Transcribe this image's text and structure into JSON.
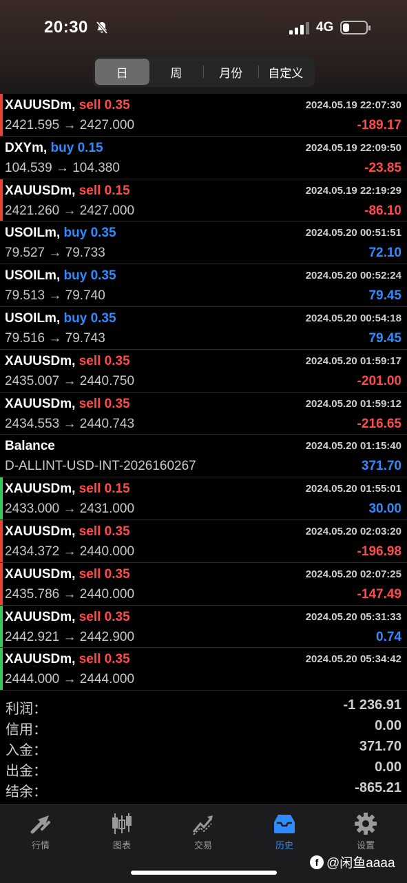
{
  "status": {
    "time": "20:30",
    "network": "4G"
  },
  "segments": [
    {
      "label": "日",
      "active": true
    },
    {
      "label": "周",
      "active": false
    },
    {
      "label": "月份",
      "active": false
    },
    {
      "label": "自定义",
      "active": false
    }
  ],
  "trades": [
    {
      "symbol": "XAUUSDm,",
      "side": "sell",
      "volume": "0.35",
      "date": "2024.05.19 22:07:30",
      "prices": "2421.595 → 2427.000",
      "profit": "-189.17",
      "bar": "#e8413a"
    },
    {
      "symbol": "DXYm,",
      "side": "buy",
      "volume": "0.15",
      "date": "2024.05.19 22:09:50",
      "prices": "104.539 → 104.380",
      "profit": "-23.85",
      "bar": ""
    },
    {
      "symbol": "XAUUSDm,",
      "side": "sell",
      "volume": "0.15",
      "date": "2024.05.19 22:19:29",
      "prices": "2421.260 → 2427.000",
      "profit": "-86.10",
      "bar": "#e8413a"
    },
    {
      "symbol": "USOILm,",
      "side": "buy",
      "volume": "0.35",
      "date": "2024.05.20 00:51:51",
      "prices": "79.527 → 79.733",
      "profit": "72.10",
      "bar": ""
    },
    {
      "symbol": "USOILm,",
      "side": "buy",
      "volume": "0.35",
      "date": "2024.05.20 00:52:24",
      "prices": "79.513 → 79.740",
      "profit": "79.45",
      "bar": ""
    },
    {
      "symbol": "USOILm,",
      "side": "buy",
      "volume": "0.35",
      "date": "2024.05.20 00:54:18",
      "prices": "79.516 → 79.743",
      "profit": "79.45",
      "bar": ""
    },
    {
      "symbol": "XAUUSDm,",
      "side": "sell",
      "volume": "0.35",
      "date": "2024.05.20 01:59:17",
      "prices": "2435.007 → 2440.750",
      "profit": "-201.00",
      "bar": ""
    },
    {
      "symbol": "XAUUSDm,",
      "side": "sell",
      "volume": "0.35",
      "date": "2024.05.20 01:59:12",
      "prices": "2434.553 → 2440.743",
      "profit": "-216.65",
      "bar": ""
    },
    {
      "symbol": "Balance",
      "side": "",
      "volume": "",
      "date": "2024.05.20 01:15:40",
      "prices": "D-ALLINT-USD-INT-2026160267",
      "profit": "371.70",
      "bar": ""
    },
    {
      "symbol": "XAUUSDm,",
      "side": "sell",
      "volume": "0.15",
      "date": "2024.05.20 01:55:01",
      "prices": "2433.000 → 2431.000",
      "profit": "30.00",
      "bar": "#35c759"
    },
    {
      "symbol": "XAUUSDm,",
      "side": "sell",
      "volume": "0.35",
      "date": "2024.05.20 02:03:20",
      "prices": "2434.372 → 2440.000",
      "profit": "-196.98",
      "bar": "#e8413a"
    },
    {
      "symbol": "XAUUSDm,",
      "side": "sell",
      "volume": "0.35",
      "date": "2024.05.20 02:07:25",
      "prices": "2435.786 → 2440.000",
      "profit": "-147.49",
      "bar": "#e8413a"
    },
    {
      "symbol": "XAUUSDm,",
      "side": "sell",
      "volume": "0.35",
      "date": "2024.05.20 05:31:33",
      "prices": "2442.921 → 2442.900",
      "profit": "0.74",
      "bar": "#35c759"
    },
    {
      "symbol": "XAUUSDm,",
      "side": "sell",
      "volume": "0.35",
      "date": "2024.05.20 05:34:42",
      "prices": "2444.000 → 2444.000",
      "profit": "",
      "bar": "#35c759"
    }
  ],
  "summary": [
    {
      "label": "利润：",
      "value": "-1 236.91"
    },
    {
      "label": "信用：",
      "value": "0.00"
    },
    {
      "label": "入金：",
      "value": "371.70"
    },
    {
      "label": "出金：",
      "value": "0.00"
    },
    {
      "label": "结余：",
      "value": "-865.21"
    }
  ],
  "tabs": [
    {
      "label": "行情",
      "icon": "quotes-icon",
      "active": false
    },
    {
      "label": "图表",
      "icon": "chart-icon",
      "active": false
    },
    {
      "label": "交易",
      "icon": "trade-icon",
      "active": false
    },
    {
      "label": "历史",
      "icon": "history-icon",
      "active": true
    },
    {
      "label": "设置",
      "icon": "settings-icon",
      "active": false
    }
  ],
  "watermark": "@闲鱼aaaa",
  "colors": {
    "sell": "#ff4b4b",
    "buy": "#2f8cff",
    "active_tab": "#2f8cff"
  }
}
